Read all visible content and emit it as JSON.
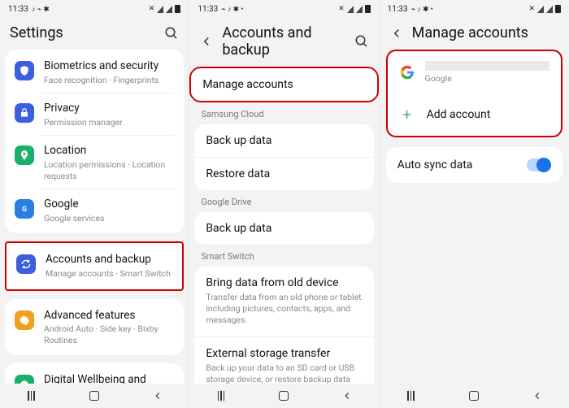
{
  "status": {
    "time": "11:33",
    "icons": "⌁ ♪ ✱"
  },
  "screen1": {
    "title": "Settings",
    "items": [
      {
        "label": "Biometrics and security",
        "sub": "Face recognition · Fingerprints",
        "ic": "shield",
        "bg": "#3b5fe0"
      },
      {
        "label": "Privacy",
        "sub": "Permission manager",
        "ic": "lock",
        "bg": "#3b5fe0"
      },
      {
        "label": "Location",
        "sub": "Location permissions · Location requests",
        "ic": "pin",
        "bg": "#1ab06a"
      },
      {
        "label": "Google",
        "sub": "Google services",
        "ic": "g",
        "bg": "#2a7de1"
      },
      {
        "label": "Accounts and backup",
        "sub": "Manage accounts · Smart Switch",
        "ic": "sync",
        "bg": "#3b5fe0",
        "highlight": true
      },
      {
        "label": "Advanced features",
        "sub": "Android Auto · Side key · Bixby Routines",
        "ic": "gear",
        "bg": "#f0a020"
      },
      {
        "label": "Digital Wellbeing and",
        "sub": "",
        "ic": "circle",
        "bg": "#1ab06a"
      }
    ]
  },
  "screen2": {
    "title": "Accounts and backup",
    "groups": [
      {
        "header": null,
        "rows": [
          {
            "label": "Manage accounts",
            "sub": null,
            "highlight": true
          }
        ]
      },
      {
        "header": "Samsung Cloud",
        "rows": [
          {
            "label": "Back up data",
            "sub": null
          },
          {
            "label": "Restore data",
            "sub": null
          }
        ]
      },
      {
        "header": "Google Drive",
        "rows": [
          {
            "label": "Back up data",
            "sub": null
          }
        ]
      },
      {
        "header": "Smart Switch",
        "rows": [
          {
            "label": "Bring data from old device",
            "sub": "Transfer data from an old phone or tablet including pictures, contacts, apps, and messages."
          },
          {
            "label": "External storage transfer",
            "sub": "Back up your data to an SD card or USB storage device, or restore backup data using Smart Switch."
          }
        ]
      }
    ]
  },
  "screen3": {
    "title": "Manage accounts",
    "account": {
      "provider": "Google"
    },
    "add_label": "Add account",
    "sync_label": "Auto sync data",
    "sync_on": true
  }
}
